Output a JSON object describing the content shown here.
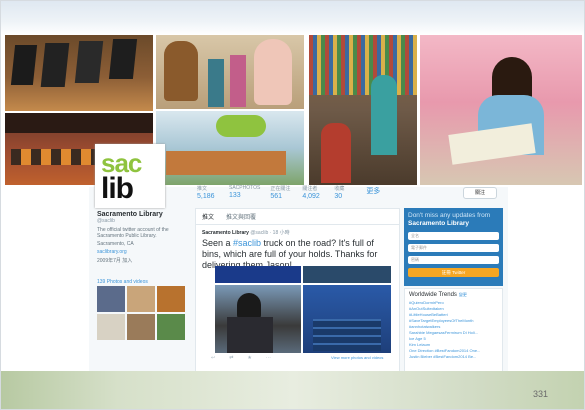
{
  "slide": {
    "number": "331"
  },
  "profile": {
    "name": "Sacramento Library",
    "handle": "@saclib",
    "bio": "The official twitter account of the Sacramento Public Library.",
    "location": "Sacramento, CA",
    "website": "saclibrary.org",
    "joined": "2009年7月 加入",
    "photos_label": "139 Photos and videos"
  },
  "logo": {
    "line1": "sac",
    "line2": "lib"
  },
  "stats": [
    {
      "label": "推文",
      "value": "5,186"
    },
    {
      "label": "SACPHOTOS",
      "value": "133"
    },
    {
      "label": "正在關注",
      "value": "561"
    },
    {
      "label": "關注者",
      "value": "4,092"
    },
    {
      "label": "收藏",
      "value": "30"
    },
    {
      "label": "",
      "value": "更多"
    }
  ],
  "follow_button": "關注",
  "tabs": [
    "推文",
    "推文與回覆"
  ],
  "tweet": {
    "author": "Sacramento Library",
    "handle": "@saclib · 18 小時",
    "text_before": "Seen a ",
    "mention": "#saclib",
    "text_after": " truck on the road? It's full of bins, which are full of your holds. Thanks for delivering them Jason!",
    "view_more": "View more photos and videos"
  },
  "signup": {
    "line1": "Don't miss any updates from",
    "line2": "Sacramento Library",
    "name_placeholder": "全名",
    "email_placeholder": "電子郵件",
    "password_placeholder": "密碼",
    "button": "註冊 Twitter"
  },
  "trends": {
    "title": "Worldwide Trends",
    "change": "變更",
    "items": [
      "#QuieroDormirPero",
      "#AnOutSuitedtaken",
      "#LittleHouseBeBatteri",
      "#SaveTargetEmployeesOfTheMonth",
      "#annhotatwalkers",
      "Sarahbie MegaesasFermirum Di Holi...",
      "Ice Age 5",
      "Kim Lelaum",
      "One Direction #BestFandom2014 One...",
      "Justin Bieber #BestFandom2014 Be..."
    ]
  }
}
